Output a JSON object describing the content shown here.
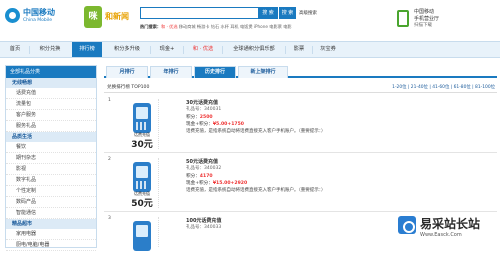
{
  "header": {
    "logo_cn": "中国移动",
    "logo_en": "China Mobile",
    "brand_badge": "咪",
    "brand_text": "和新闻",
    "search_btn": "搜 索",
    "search_btn2": "搜 索",
    "advanced": "高级搜索",
    "hot_label": "热门搜索：",
    "hot_red": "和 · 优选",
    "hot_rest": " 移动商城 畅游卡 钻石 水杯 耳机 电饭煲 iPhone 电影票 电影",
    "hall_line1": "中国移动",
    "hall_line2": "手机营业厅",
    "hall_line3": "扫描下载"
  },
  "nav": {
    "items": [
      "首页",
      "积分兑换",
      "排行榜",
      "积分多升级",
      "现金+",
      "和 · 优选",
      "全球通积分俱乐部",
      "影票",
      "灰宝券"
    ]
  },
  "sidebar": {
    "title": "全部礼品分类",
    "groups": [
      {
        "name": "无线畅想",
        "items": [
          "话费充值",
          "流量包",
          "客户服务",
          "服务礼品"
        ]
      },
      {
        "name": "品质生活",
        "items": [
          "餐饮",
          "期刊杂志",
          "影视",
          "数字礼品",
          "个性定制",
          "数码产品",
          "智能通信"
        ]
      },
      {
        "name": "精品超市",
        "items": [
          "家用电器",
          "厨电/电脑/电器"
        ]
      }
    ]
  },
  "tabs": [
    "月排行",
    "年排行",
    "历史排行",
    "新上架排行"
  ],
  "list": {
    "title": "兑换排行榜 TOP100",
    "pager": "1-20位 | 21-40位 | 41-60位 | 61-80位 | 81-100位"
  },
  "items": [
    {
      "rank": "1",
      "label": "话费充值",
      "amount": "30元",
      "name": "30元话费充值",
      "code": "礼品号：340031",
      "points_label": "积分：",
      "points": "2500",
      "cash_label": "现金+积分：",
      "cash": "¥5.00+1750",
      "desc": "话费充值，是指系统自动将话费直接充入客户手机账户。（重要提示：）",
      "buy": "立即兑换",
      "fav": "加入收藏"
    },
    {
      "rank": "2",
      "label": "话费充值",
      "amount": "50元",
      "name": "50元话费充值",
      "code": "礼品号：340032",
      "points_label": "积分：",
      "points": "4170",
      "cash_label": "现金+积分：",
      "cash": "¥15.00+2920",
      "desc": "话费充值，是指系统自动将话费直接充入客户手机账户。（重要提示：）",
      "buy": "立即兑换",
      "fav": "加入收藏"
    },
    {
      "rank": "3",
      "label": "话费充值",
      "amount": "100元",
      "name": "100元话费充值",
      "code": "礼品号：340033",
      "points_label": "积分：",
      "points": "",
      "cash_label": "",
      "cash": "",
      "desc": "",
      "buy": "立即兑换",
      "fav": "加入收藏"
    }
  ],
  "watermark": {
    "title": "易采站长站",
    "url": "Www.Easck.Com"
  }
}
